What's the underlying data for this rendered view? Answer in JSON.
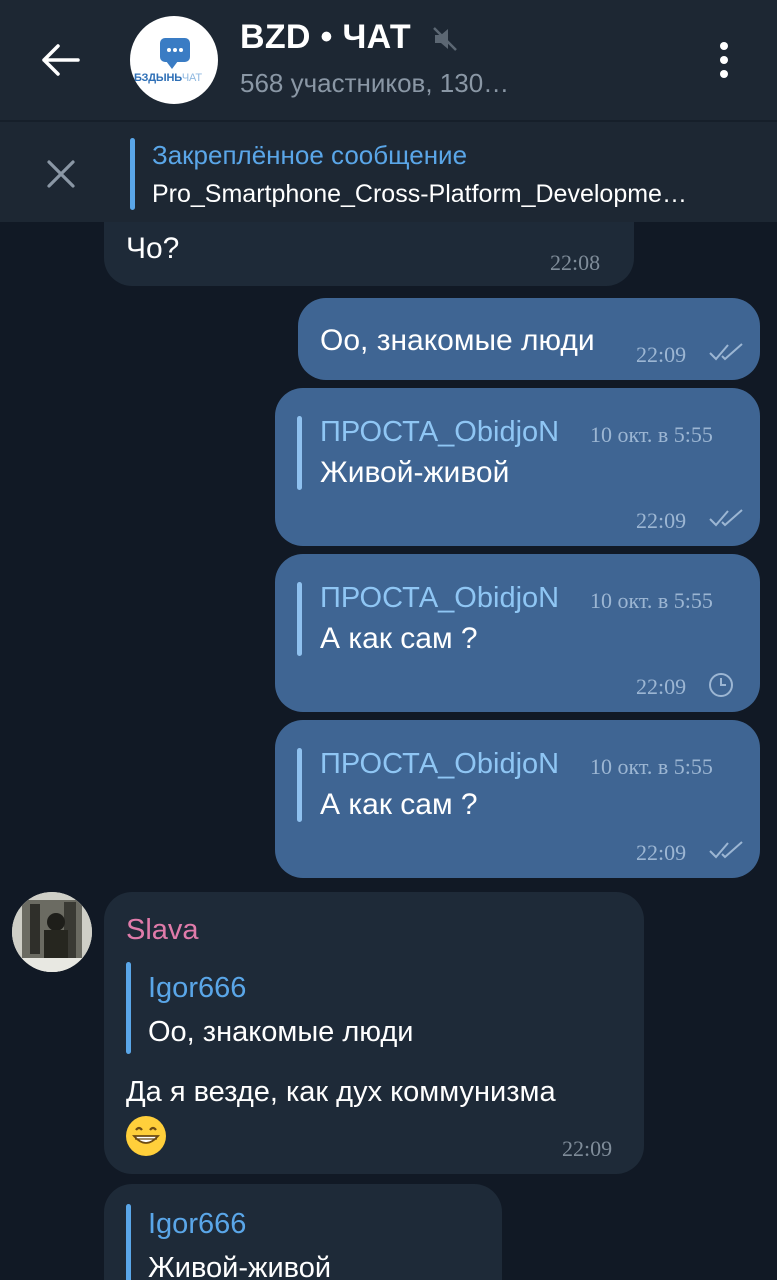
{
  "header": {
    "title": "BZD • ЧАТ",
    "subtitle": "568 участников, 130…",
    "avatar_logo_text": "БЗДЫНЬ",
    "avatar_logo_suffix": "ЧАТ"
  },
  "pinned": {
    "label": "Закреплённое сообщение",
    "text": "Pro_Smartphone_Cross-Platform_Developme…"
  },
  "messages": [
    {
      "type": "in",
      "text": "Чо?",
      "time": "22:08"
    },
    {
      "type": "out",
      "text": "Оо, знакомые люди",
      "time": "22:09",
      "status": "read"
    },
    {
      "type": "out",
      "reply_name": "ПРОСТА_ObidjoN",
      "reply_date": "10 окт. в 5:55",
      "text": "Живой-живой",
      "time": "22:09",
      "status": "read"
    },
    {
      "type": "out",
      "reply_name": "ПРОСТА_ObidjoN",
      "reply_date": "10 окт. в 5:55",
      "text": "А как сам ?",
      "time": "22:09",
      "status": "pending"
    },
    {
      "type": "out",
      "reply_name": "ПРОСТА_ObidjoN",
      "reply_date": "10 окт. в 5:55",
      "text": "А как сам ?",
      "time": "22:09",
      "status": "read"
    },
    {
      "type": "in",
      "sender": "Slava",
      "reply_name": "Igor666",
      "reply_text": "Оо, знакомые люди",
      "text": "Да я везде, как дух коммунизма",
      "time": "22:09",
      "emoji": "grinning-face"
    },
    {
      "type": "in",
      "reply_name": "Igor666",
      "reply_text": "Живой-живой"
    }
  ],
  "colors": {
    "background": "#111925",
    "header": "#1d2733",
    "incoming": "#1e2a38",
    "outgoing": "#3f6593",
    "accent": "#5aa6e8",
    "sender_name": "#e07baa"
  }
}
